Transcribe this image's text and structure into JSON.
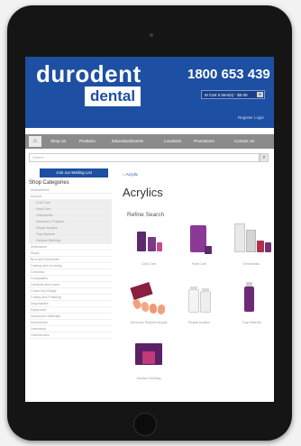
{
  "brand": {
    "name_line1": "durodent",
    "name_line2": "dental",
    "phone": "1800 653 439"
  },
  "cart": {
    "label": "M Cart 0 item(s) - $0.00",
    "caret": "▾"
  },
  "account": {
    "links": "Register Login"
  },
  "nav": {
    "home_icon": "home-icon",
    "items": [
      "Shop Us",
      "Products",
      "Education/Events",
      "Locations",
      "Promotions",
      "Contact Us"
    ]
  },
  "search": {
    "placeholder": "Search",
    "icon": "search-icon"
  },
  "mailing": {
    "label": "Join our Mailing List"
  },
  "sidebar": {
    "title": "Shop Categories",
    "items": [
      {
        "label": "Anaesthetics",
        "sub": false
      },
      {
        "label": "Acrylics",
        "sub": false
      },
      {
        "label": "Cold Cure",
        "sub": true
      },
      {
        "label": "Heat Cure",
        "sub": true
      },
      {
        "label": "Orthodontic",
        "sub": true
      },
      {
        "label": "Monomer / Polymer",
        "sub": true
      },
      {
        "label": "Repair Acrylics",
        "sub": true
      },
      {
        "label": "Tray Material",
        "sub": true
      },
      {
        "label": "Denture Relining",
        "sub": true
      },
      {
        "label": "Articulators",
        "sub": false
      },
      {
        "label": "Alloys",
        "sub": false
      },
      {
        "label": "Burs and Diamonds",
        "sub": false
      },
      {
        "label": "Casting and Investing",
        "sub": false
      },
      {
        "label": "Ceramics",
        "sub": false
      },
      {
        "label": "Composites",
        "sub": false
      },
      {
        "label": "Cements and Liners",
        "sub": false
      },
      {
        "label": "Crown and Bridge",
        "sub": false
      },
      {
        "label": "Cutting and Polishing",
        "sub": false
      },
      {
        "label": "Disposables",
        "sub": false
      },
      {
        "label": "Equipment",
        "sub": false
      },
      {
        "label": "Impression Materials",
        "sub": false
      },
      {
        "label": "Instruments",
        "sub": false
      },
      {
        "label": "Laboratory",
        "sub": false
      },
      {
        "label": "Orthodontics",
        "sub": false
      }
    ]
  },
  "main": {
    "breadcrumb": "⌂ Acrylic",
    "title": "Acrylics",
    "refine_label": "Refine Search",
    "products": [
      {
        "name": "Cold Cure"
      },
      {
        "name": "Heat Cure"
      },
      {
        "name": "Orthodontic"
      },
      {
        "name": "Monomer Polymer Acrylic"
      },
      {
        "name": "Repair Acrylics"
      },
      {
        "name": "Tray Material"
      },
      {
        "name": "Denture Relining"
      }
    ]
  },
  "colors": {
    "brand_blue": "#1d4fa3",
    "nav_grey": "#8b8b8b"
  }
}
